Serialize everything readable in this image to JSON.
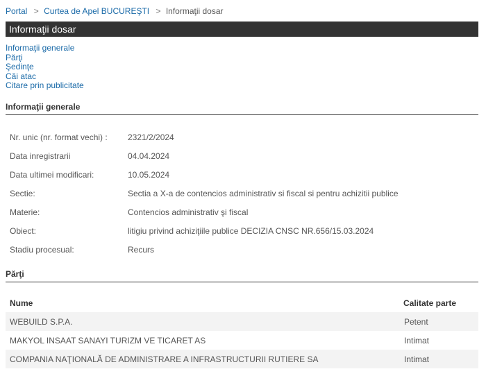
{
  "breadcrumb": {
    "items": [
      "Portal",
      "Curtea de Apel BUCUREŞTI"
    ],
    "separator": ">",
    "current": "Informaţii dosar"
  },
  "page_title": "Informaţii dosar",
  "anchors": [
    "Informaţii generale",
    "Părţi",
    "Şedinţe",
    "Căi atac",
    "Citare prin publicitate"
  ],
  "general": {
    "heading": "Informaţii generale",
    "rows": [
      {
        "label": "Nr. unic (nr. format vechi) :",
        "value": "2321/2/2024"
      },
      {
        "label": "Data inregistrarii",
        "value": "04.04.2024"
      },
      {
        "label": "Data ultimei modificari:",
        "value": "10.05.2024"
      },
      {
        "label": "Sectie:",
        "value": "Sectia a X-a de contencios administrativ si fiscal si pentru achizitii publice"
      },
      {
        "label": "Materie:",
        "value": "Contencios administrativ şi fiscal"
      },
      {
        "label": "Obiect:",
        "value": "litigiu privind achiziţiile publice DECIZIA CNSC NR.656/15.03.2024"
      },
      {
        "label": "Stadiu procesual:",
        "value": "Recurs"
      }
    ]
  },
  "parti": {
    "heading": "Părţi",
    "columns": [
      "Nume",
      "Calitate parte"
    ],
    "rows": [
      {
        "nume": "WEBUILD S.P.A.",
        "calitate": "Petent"
      },
      {
        "nume": "MAKYOL INSAAT SANAYI TURIZM VE TICARET AS",
        "calitate": "Intimat"
      },
      {
        "nume": "COMPANIA NAŢIONALĂ DE ADMINISTRARE A INFRASTRUCTURII RUTIERE SA",
        "calitate": "Intimat"
      }
    ]
  }
}
